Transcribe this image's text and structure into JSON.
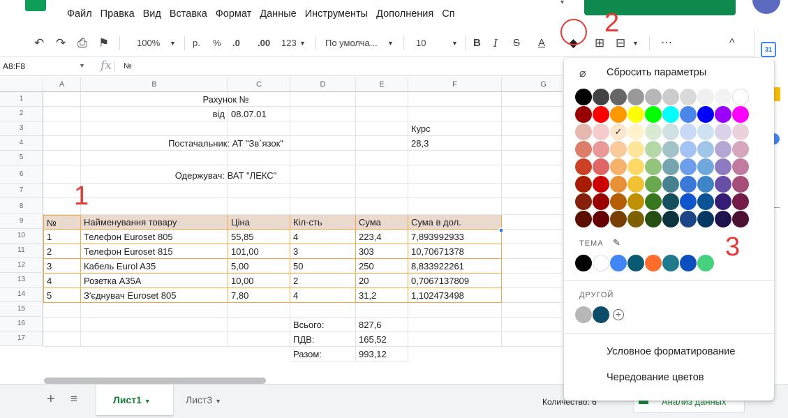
{
  "menu": [
    "Файл",
    "Правка",
    "Вид",
    "Вставка",
    "Формат",
    "Данные",
    "Инструменты",
    "Дополнения",
    "Сп"
  ],
  "toolbar": {
    "zoom": "100%",
    "currency": "р.",
    "percent": "%",
    "dec_less": ".0",
    "dec_more": ".00",
    "format_more": "123",
    "font": "По умолча...",
    "font_size": "10",
    "bold": "B",
    "italic": "I",
    "strike": "S",
    "text_color": "A",
    "more": "⋯",
    "collapse": "^"
  },
  "formula_bar": {
    "name_box": "A8:F8",
    "fx": "fx",
    "value": "№"
  },
  "columns": [
    "A",
    "B",
    "C",
    "D",
    "E",
    "F",
    "G"
  ],
  "rows": [
    "1",
    "2",
    "3",
    "4",
    "5",
    "6",
    "7",
    "8",
    "9",
    "10",
    "11",
    "12",
    "13",
    "14",
    "15",
    "16",
    "17"
  ],
  "sheet": {
    "title": "Рахунок №",
    "date_label": "від",
    "date": "08.07.01",
    "rate_label": "Курс",
    "supplier": "Постачальник: АТ \"Зв`язок\"",
    "rate": "28,3",
    "recipient": "Одержувач: ВАТ \"ЛЕКС\"",
    "header": [
      "№",
      "Найменування товару",
      "Ціна",
      "Кіл-сть",
      "Сума",
      "Сума в дол."
    ],
    "items": [
      [
        "1",
        "Телефон Euroset 805",
        "55,85",
        "4",
        "223,4",
        "7,893992933"
      ],
      [
        "2",
        "Телефон Euroset 815",
        "101,00",
        "3",
        "303",
        "10,70671378"
      ],
      [
        "3",
        "Кабель  Eurol A35",
        "5,00",
        "50",
        "250",
        "8,833922261"
      ],
      [
        "4",
        "Розетка A35A",
        "10,00",
        "2",
        "20",
        "0,7067137809"
      ],
      [
        "5",
        "З'єднувач Euroset 805",
        "7,80",
        "4",
        "31,2",
        "1,102473498"
      ]
    ],
    "totals": [
      [
        "Всього:",
        "827,6"
      ],
      [
        "ПДВ:",
        "165,52"
      ],
      [
        "Разом:",
        "993,12"
      ]
    ]
  },
  "tabs": {
    "sheet1": "Лист1",
    "sheet3": "Лист3"
  },
  "status": {
    "count": "Количество: 6",
    "explore": "Анализ данных"
  },
  "color_menu": {
    "reset": "Сбросить параметры",
    "theme": "ТЕМА",
    "custom": "ДРУГОЙ",
    "conditional": "Условное форматирование",
    "alternating": "Чередование цветов",
    "palette": [
      [
        "#000000",
        "#434343",
        "#666666",
        "#999999",
        "#b7b7b7",
        "#cccccc",
        "#d9d9d9",
        "#efefef",
        "#f3f3f3",
        "#ffffff"
      ],
      [
        "#980000",
        "#ff0000",
        "#ff9900",
        "#ffff00",
        "#00ff00",
        "#00ffff",
        "#4a86e8",
        "#0000ff",
        "#9900ff",
        "#ff00ff"
      ],
      [
        "#e6b8af",
        "#f4cccc",
        "#fce5cd",
        "#fff2cc",
        "#d9ead3",
        "#d0e0e3",
        "#c9daf8",
        "#cfe2f3",
        "#d9d2e9",
        "#ead1dc"
      ],
      [
        "#dd7e6b",
        "#ea9999",
        "#f9cb9c",
        "#ffe599",
        "#b6d7a8",
        "#a2c4c9",
        "#a4c2f4",
        "#9fc5e8",
        "#b4a7d6",
        "#d5a6bd"
      ],
      [
        "#cc4125",
        "#e06666",
        "#f6b26b",
        "#ffd966",
        "#93c47d",
        "#76a5af",
        "#6d9eeb",
        "#6fa8dc",
        "#8e7cc3",
        "#c27ba0"
      ],
      [
        "#a61c00",
        "#cc0000",
        "#e69138",
        "#f1c232",
        "#6aa84f",
        "#45818e",
        "#3c78d8",
        "#3d85c6",
        "#674ea7",
        "#a64d79"
      ],
      [
        "#85200c",
        "#990000",
        "#b45f06",
        "#bf9000",
        "#38761d",
        "#134f5c",
        "#1155cc",
        "#0b5394",
        "#351c75",
        "#741b47"
      ],
      [
        "#5b0f00",
        "#660000",
        "#783f04",
        "#7f6000",
        "#274e13",
        "#0c343d",
        "#1c4587",
        "#073763",
        "#20124d",
        "#4c1130"
      ]
    ],
    "selected": "✓",
    "theme_colors": [
      "#000000",
      "#ffffff",
      "#4285f4",
      "#0b5a73",
      "#ff6d2d",
      "#1e7a8c",
      "#0e4fbf",
      "#46d17f"
    ],
    "custom_colors": [
      "#b7b7b7",
      "#0b4d66"
    ]
  },
  "annotations": [
    "1",
    "2",
    "3"
  ],
  "side_panel": {
    "calendar": "31"
  }
}
